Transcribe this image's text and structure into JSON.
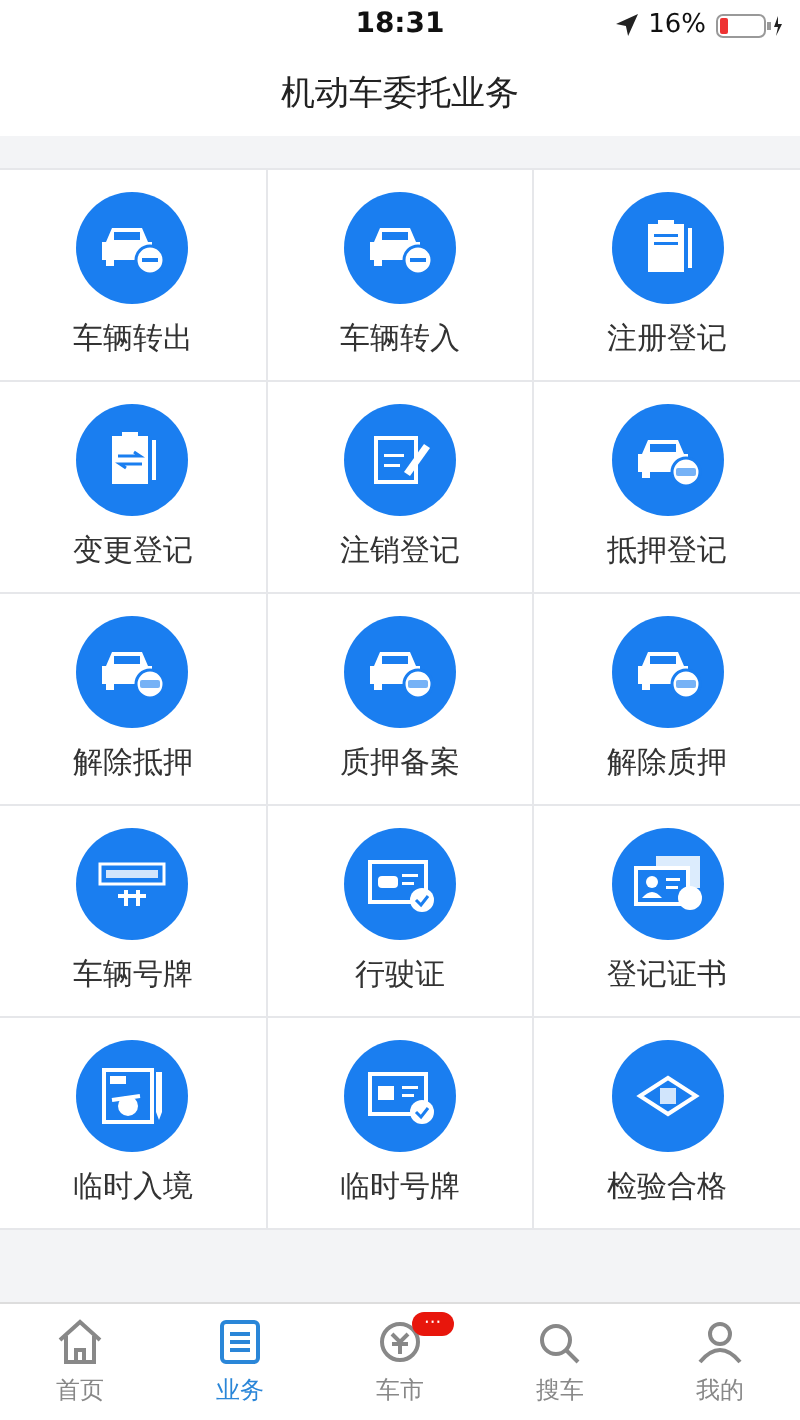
{
  "status_bar": {
    "time": "18:31",
    "battery": "16%"
  },
  "header": {
    "title": "机动车委托业务"
  },
  "services": [
    {
      "label": "车辆转出",
      "kind": "car-minus"
    },
    {
      "label": "车辆转入",
      "kind": "car-minus"
    },
    {
      "label": "注册登记",
      "kind": "clipboard"
    },
    {
      "label": "变更登记",
      "kind": "clipboard-swap"
    },
    {
      "label": "注销登记",
      "kind": "form-pen"
    },
    {
      "label": "抵押登记",
      "kind": "car-badge"
    },
    {
      "label": "解除抵押",
      "kind": "car-badge"
    },
    {
      "label": "质押备案",
      "kind": "car-badge"
    },
    {
      "label": "解除质押",
      "kind": "car-badge"
    },
    {
      "label": "车辆号牌",
      "kind": "plate"
    },
    {
      "label": "行驶证",
      "kind": "license"
    },
    {
      "label": "登记证书",
      "kind": "certificate"
    },
    {
      "label": "临时入境",
      "kind": "entry"
    },
    {
      "label": "临时号牌",
      "kind": "temp-plate"
    },
    {
      "label": "检验合格",
      "kind": "diamond"
    }
  ],
  "tab_bar": [
    {
      "label": "首页",
      "kind": "home",
      "selected": false
    },
    {
      "label": "业务",
      "kind": "list",
      "selected": true
    },
    {
      "label": "车市",
      "kind": "coin",
      "selected": false,
      "badge": "···"
    },
    {
      "label": "搜车",
      "kind": "search",
      "selected": false
    },
    {
      "label": "我的",
      "kind": "person",
      "selected": false
    }
  ]
}
